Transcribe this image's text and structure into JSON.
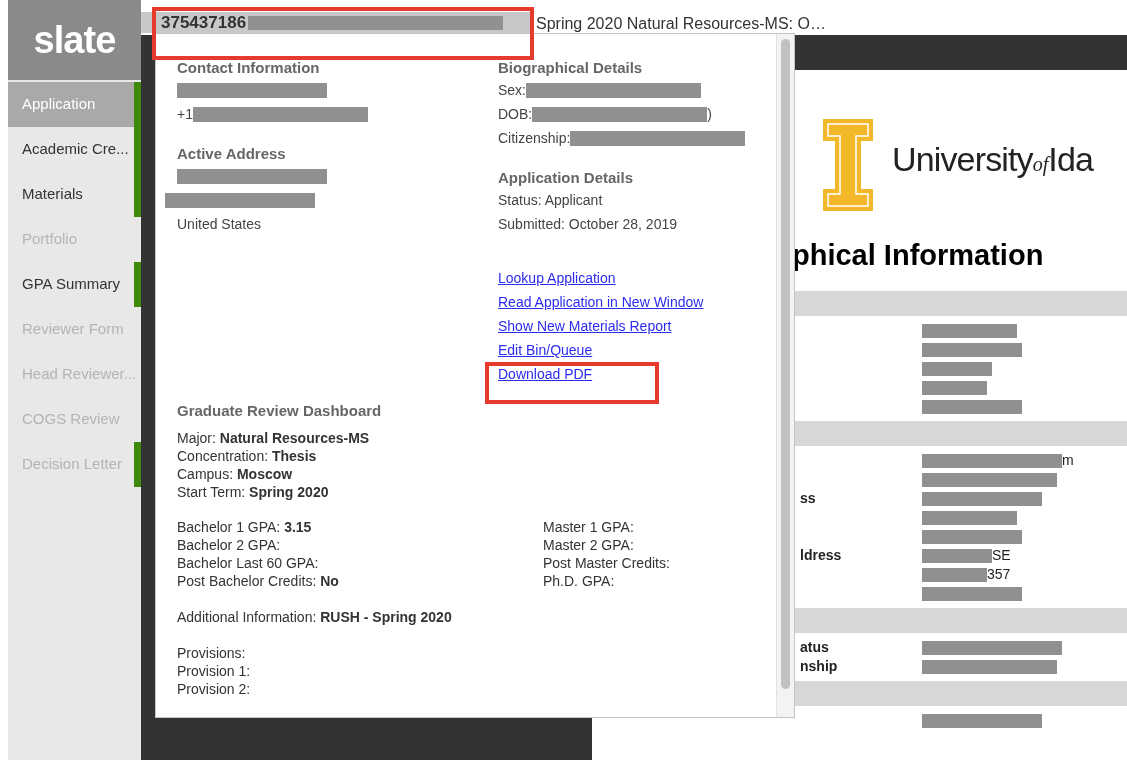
{
  "sidebar": {
    "logo": "slate",
    "items": [
      {
        "label": "Application",
        "selected": true,
        "disabled": false,
        "marked": true
      },
      {
        "label": "Academic Cre...",
        "selected": false,
        "disabled": false,
        "marked": true
      },
      {
        "label": "Materials",
        "selected": false,
        "disabled": false,
        "marked": true
      },
      {
        "label": "Portfolio",
        "selected": false,
        "disabled": true,
        "marked": false
      },
      {
        "label": "GPA Summary",
        "selected": false,
        "disabled": false,
        "marked": true
      },
      {
        "label": "Reviewer Form",
        "selected": false,
        "disabled": true,
        "marked": false
      },
      {
        "label": "Head Reviewer...",
        "selected": false,
        "disabled": true,
        "marked": false
      },
      {
        "label": "COGS Review",
        "selected": false,
        "disabled": true,
        "marked": false
      },
      {
        "label": "Decision Letter",
        "selected": false,
        "disabled": true,
        "marked": true
      }
    ]
  },
  "header": {
    "record_id": "375437186",
    "subtitle": "Spring 2020 Natural Resources-MS: O…"
  },
  "popup": {
    "left": [
      {
        "title": "Contact Information",
        "lines": [
          [
            {
              "kind": "redaction"
            }
          ],
          [
            {
              "kind": "text",
              "text": "+1"
            },
            {
              "kind": "redaction"
            }
          ]
        ]
      },
      {
        "title": "Active Address",
        "lines": [
          [
            {
              "kind": "redaction"
            }
          ],
          [
            {
              "kind": "redaction"
            }
          ],
          [
            {
              "kind": "text",
              "text": "United States"
            }
          ]
        ]
      }
    ],
    "right": [
      {
        "title": "Biographical Details",
        "lines": [
          [
            {
              "kind": "text",
              "text": "Sex:"
            },
            {
              "kind": "redaction"
            }
          ],
          [
            {
              "kind": "text",
              "text": "DOB:"
            },
            {
              "kind": "redaction"
            },
            {
              "kind": "text",
              "text": ")"
            }
          ],
          [
            {
              "kind": "text",
              "text": "Citizenship:"
            },
            {
              "kind": "redaction"
            }
          ]
        ]
      },
      {
        "title": "Application Details",
        "lines": [
          [
            {
              "kind": "text",
              "text": "Status: Applicant"
            }
          ],
          [
            {
              "kind": "text",
              "text": "Submitted: October 28, 2019"
            }
          ]
        ]
      }
    ],
    "links": [
      "Lookup Application",
      "Read Application in New Window",
      "Show New Materials Report",
      "Edit Bin/Queue",
      "Download PDF"
    ],
    "dashboard": {
      "title": "Graduate Review Dashboard",
      "program": [
        "Major: **Natural Resources-MS**",
        "Concentration: **Thesis**",
        "Campus: **Moscow**",
        "Start Term: **Spring 2020**"
      ],
      "gpa_left": [
        "Bachelor 1 GPA: **3.15**",
        "Bachelor 2 GPA:",
        "Bachelor Last 60 GPA:",
        "Post Bachelor Credits: **No**"
      ],
      "gpa_right": [
        "Master 1 GPA:",
        "Master 2 GPA:",
        "Post Master Credits:",
        "Ph.D. GPA:"
      ],
      "additional": "Additional Information: **RUSH - Spring 2020**",
      "provisions": [
        "Provisions:",
        "Provision 1:",
        "Provision 2:"
      ]
    }
  },
  "document": {
    "logo": {
      "word1": "University",
      "word2": "of",
      "word3": "Ida"
    },
    "heading": "phical Information",
    "rows": [
      {
        "kind": "band"
      },
      {
        "kind": "field",
        "label": "",
        "values": [
          {
            "kind": "redaction"
          }
        ]
      },
      {
        "kind": "field",
        "label": "",
        "values": [
          {
            "kind": "redaction"
          }
        ]
      },
      {
        "kind": "field",
        "label": "",
        "values": [
          {
            "kind": "redaction"
          }
        ]
      },
      {
        "kind": "field",
        "label": "",
        "values": [
          {
            "kind": "redaction"
          }
        ]
      },
      {
        "kind": "field",
        "label": "",
        "values": [
          {
            "kind": "redaction"
          }
        ]
      },
      {
        "kind": "band"
      },
      {
        "kind": "field",
        "label": "",
        "values": [
          {
            "kind": "redaction"
          },
          {
            "kind": "text",
            "text": "m"
          }
        ]
      },
      {
        "kind": "field",
        "label": "",
        "values": [
          {
            "kind": "redaction"
          }
        ]
      },
      {
        "kind": "field",
        "label": "ss",
        "values": [
          {
            "kind": "redaction"
          }
        ]
      },
      {
        "kind": "field",
        "label": "",
        "values": [
          {
            "kind": "redaction"
          }
        ]
      },
      {
        "kind": "field",
        "label": "",
        "values": [
          {
            "kind": "redaction"
          }
        ]
      },
      {
        "kind": "field",
        "label": "ldress",
        "values": [
          {
            "kind": "redaction"
          },
          {
            "kind": "text",
            "text": "SE"
          }
        ]
      },
      {
        "kind": "field",
        "label": "",
        "values": [
          {
            "kind": "redaction"
          },
          {
            "kind": "text",
            "text": "357"
          }
        ]
      },
      {
        "kind": "field",
        "label": "",
        "values": [
          {
            "kind": "redaction"
          }
        ]
      },
      {
        "kind": "band"
      },
      {
        "kind": "field",
        "label": "atus",
        "values": [
          {
            "kind": "redaction"
          }
        ]
      },
      {
        "kind": "field",
        "label": "nship",
        "values": [
          {
            "kind": "redaction"
          }
        ]
      },
      {
        "kind": "band"
      },
      {
        "kind": "field",
        "label": "",
        "values": [
          {
            "kind": "redaction"
          }
        ]
      }
    ]
  }
}
